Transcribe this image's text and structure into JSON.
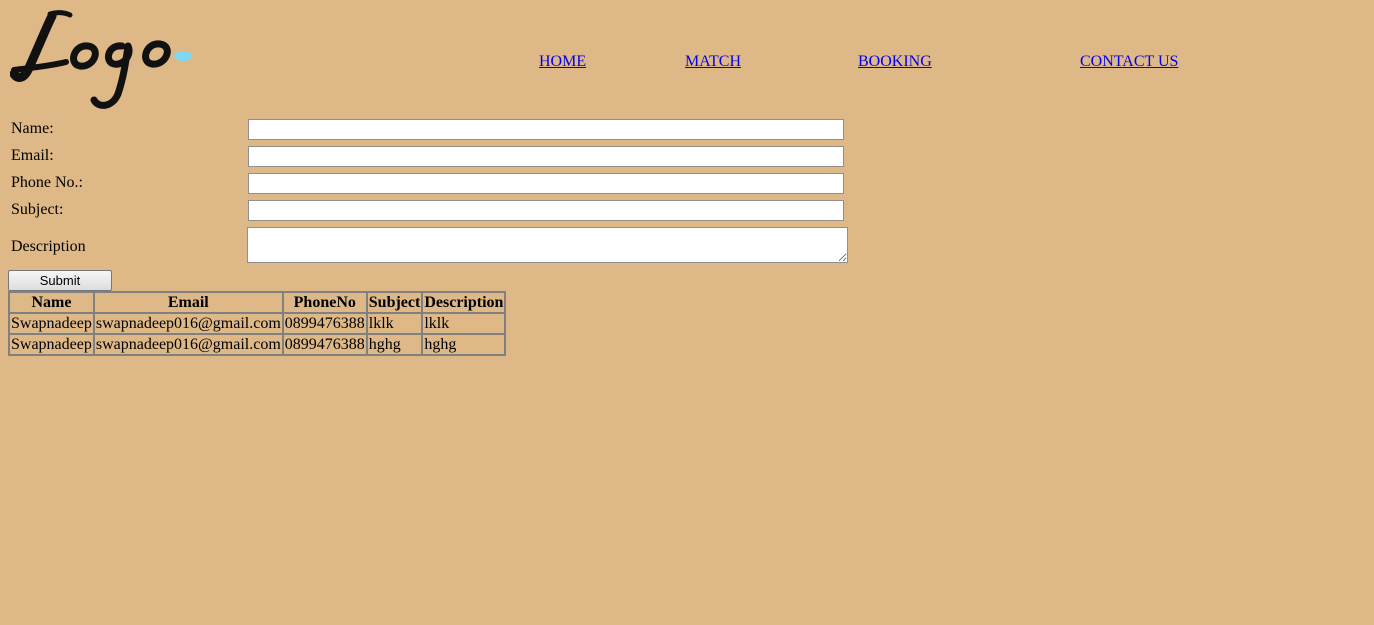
{
  "logo": {
    "text": "Logo",
    "dot_color": "#7fd8f0"
  },
  "nav": {
    "home": "HOME",
    "match": "MATCH",
    "booking": "BOOKING",
    "contact": "CONTACT US"
  },
  "form": {
    "name_label": "Name:",
    "email_label": "Email:",
    "phone_label": "Phone No.:",
    "subject_label": "Subject:",
    "description_label": "Description",
    "name_value": "",
    "email_value": "",
    "phone_value": "",
    "subject_value": "",
    "description_value": "",
    "submit_label": "Submit"
  },
  "table": {
    "headers": [
      "Name",
      "Email",
      "PhoneNo",
      "Subject",
      "Description"
    ],
    "rows": [
      [
        "Swapnadeep",
        "swapnadeep016@gmail.com",
        "0899476388",
        "lklk",
        "lklk"
      ],
      [
        "Swapnadeep",
        "swapnadeep016@gmail.com",
        "0899476388",
        "hghg",
        "hghg"
      ]
    ]
  },
  "colors": {
    "background": "#deb887",
    "link": "#0000ee",
    "logo_ink": "#111111"
  }
}
